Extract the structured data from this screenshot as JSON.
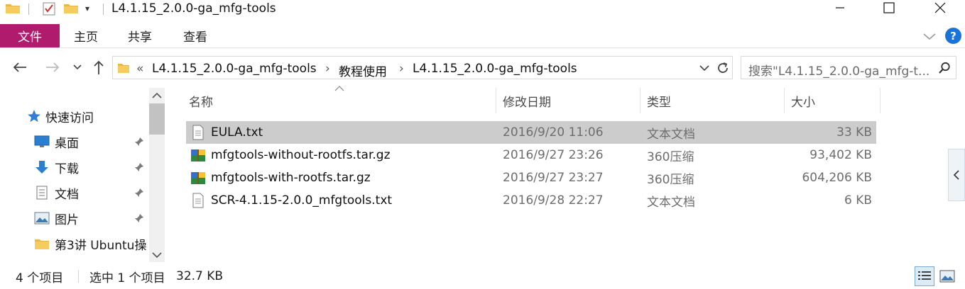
{
  "window": {
    "title": "L4.1.15_2.0.0-ga_mfg-tools",
    "minimize_glyph": "—",
    "maximize_glyph": "☐",
    "close_glyph": "✕",
    "qa_dropdown_glyph": "▾"
  },
  "ribbon": {
    "tabs": [
      "文件",
      "主页",
      "共享",
      "查看"
    ],
    "help_glyph": "?",
    "accent_color": "#b01b6d"
  },
  "nav": {
    "breadcrumb_overflow": "«",
    "breadcrumb": [
      "L4.1.15_2.0.0-ga_mfg-tools",
      "教程使用",
      "L4.1.15_2.0.0-ga_mfg-tools"
    ],
    "separator": "›",
    "search_placeholder": "搜索\"L4.1.15_2.0.0-ga_mfg-t..."
  },
  "sidebar": {
    "quick_access": "快速访问",
    "items": [
      {
        "label": "桌面",
        "icon": "desktop-icon",
        "pinned": true
      },
      {
        "label": "下载",
        "icon": "download-icon",
        "pinned": true
      },
      {
        "label": "文档",
        "icon": "documents-icon",
        "pinned": true
      },
      {
        "label": "图片",
        "icon": "pictures-icon",
        "pinned": true
      },
      {
        "label": "第3讲 Ubuntu操",
        "icon": "folder-icon",
        "pinned": false
      }
    ]
  },
  "columns": {
    "name": "名称",
    "modified": "修改日期",
    "type": "类型",
    "size": "大小"
  },
  "files": [
    {
      "name": "EULA.txt",
      "modified": "2016/9/20 11:06",
      "type": "文本文档",
      "size": "33 KB",
      "icon": "text-file-icon",
      "selected": true
    },
    {
      "name": "mfgtools-without-rootfs.tar.gz",
      "modified": "2016/9/27 23:26",
      "type": "360压缩",
      "size": "93,402 KB",
      "icon": "archive-icon",
      "selected": false
    },
    {
      "name": "mfgtools-with-rootfs.tar.gz",
      "modified": "2016/9/27 23:27",
      "type": "360压缩",
      "size": "604,206 KB",
      "icon": "archive-icon",
      "selected": false
    },
    {
      "name": "SCR-4.1.15-2.0.0_mfgtools.txt",
      "modified": "2016/9/28 22:27",
      "type": "文本文档",
      "size": "6 KB",
      "icon": "text-file-icon",
      "selected": false
    }
  ],
  "status": {
    "item_count": "4 个项目",
    "selection": "选中 1 个项目",
    "selection_size": "32.7 KB"
  }
}
